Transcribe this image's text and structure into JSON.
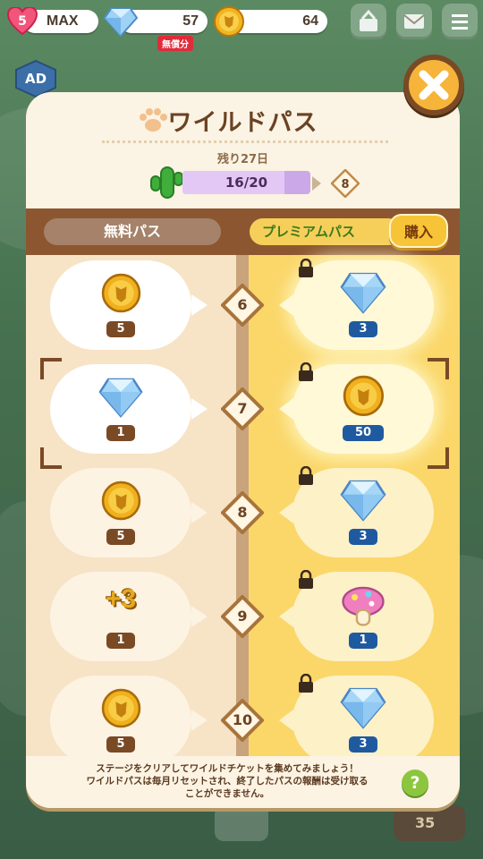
{
  "top_bar": {
    "lives_count": "5",
    "lives_status": "MAX",
    "gems": "57",
    "gems_tag": "無償分",
    "coins": "64"
  },
  "side": {
    "ad_label": "AD"
  },
  "panel": {
    "title": "ワイルドパス",
    "remaining": "残り27日",
    "progress_text": "16/20",
    "progress_fraction": 0.8,
    "next_level": "8",
    "free_pass_label": "無料パス",
    "premium_pass_label": "プレミアムパス",
    "buy_label": "購入"
  },
  "rows": [
    {
      "level": "6",
      "free_item": "coin",
      "free_count": "5",
      "prem_item": "gem",
      "prem_count": "3"
    },
    {
      "level": "7",
      "free_item": "gem",
      "free_count": "1",
      "prem_item": "coin",
      "prem_count": "50"
    },
    {
      "level": "8",
      "free_item": "coin",
      "free_count": "5",
      "prem_item": "gem",
      "prem_count": "3"
    },
    {
      "level": "9",
      "free_item": "plus3",
      "free_count": "1",
      "prem_item": "mushroom",
      "prem_count": "1"
    },
    {
      "level": "10",
      "free_item": "coin",
      "free_count": "5",
      "prem_item": "gem",
      "prem_count": "3"
    }
  ],
  "plus3_label": "+3",
  "footer": {
    "line1": "ステージをクリアしてワイルドチケットを集めてみましょう！",
    "line2": "ワイルドパスは毎月リセットされ、終了したパスの報酬は受け取る",
    "line3": "ことができません。",
    "help": "?"
  },
  "bottom": {
    "badge_number": "35"
  },
  "colors": {
    "brown": "#7a4a25",
    "gold": "#f7c437",
    "premium_bg": "#fbd76a",
    "free_bg": "#f7e3c6",
    "progress": "#cba8e8"
  }
}
